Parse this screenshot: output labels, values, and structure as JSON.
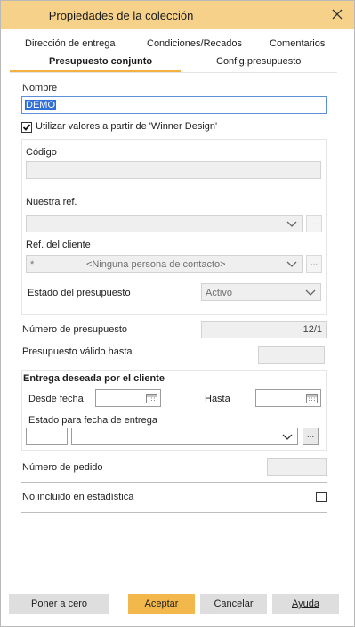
{
  "window": {
    "title": "Propiedades de la colección"
  },
  "tabs_row1": [
    "Dirección de entrega",
    "Condiciones/Recados",
    "Comentarios"
  ],
  "tabs_row2": [
    "Presupuesto conjunto",
    "Config.presupuesto"
  ],
  "active_tab": "Presupuesto conjunto",
  "fields": {
    "nombre_label": "Nombre",
    "nombre_value": "DEMO",
    "use_winner_label": "Utilizar valores a partir de 'Winner Design'",
    "use_winner_checked": true,
    "codigo_label": "Código",
    "codigo_value": "",
    "nuestra_ref_label": "Nuestra ref.",
    "ref_cliente_label": "Ref. del cliente",
    "ref_cliente_prefix": "*",
    "ref_cliente_value": "<Ninguna persona de contacto>",
    "estado_presupuesto_label": "Estado del presupuesto",
    "estado_presupuesto_value": "Activo",
    "numero_presupuesto_label": "Número de presupuesto",
    "numero_presupuesto_value": "12/1",
    "valido_hasta_label": "Presupuesto válido hasta",
    "entrega_header": "Entrega deseada por el cliente",
    "desde_fecha_label": "Desde fecha",
    "hasta_label": "Hasta",
    "estado_entrega_label": "Estado para fecha de entrega",
    "numero_pedido_label": "Número de pedido",
    "no_incluido_label": "No incluido en estadística",
    "no_incluido_checked": false
  },
  "ellipsis": "...",
  "buttons": {
    "reset": "Poner a cero",
    "accept": "Aceptar",
    "cancel": "Cancelar",
    "help": "Ayuda"
  },
  "icons": {
    "close": "close-icon",
    "chevron": "chevron-down-icon",
    "calendar": "calendar-icon",
    "check": "checkmark-icon"
  },
  "colors": {
    "titlebar": "#f6d189",
    "accent": "#f2b23d",
    "primary_button": "#f2b84b",
    "focus_border": "#5b8fd6"
  }
}
